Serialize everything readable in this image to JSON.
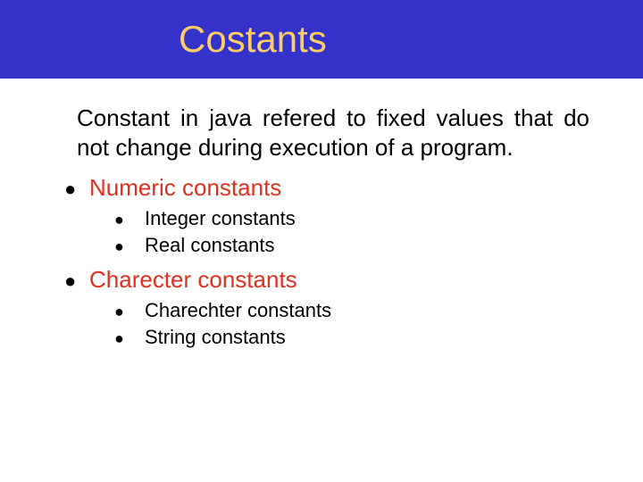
{
  "title": "Costants",
  "intro": "Constant in java refered to fixed values that do not change during execution of a program.",
  "sections": [
    {
      "heading": "Numeric constants",
      "items": [
        "Integer constants",
        "Real constants"
      ]
    },
    {
      "heading": "Charecter constants",
      "items": [
        "Charechter constants",
        "String constants"
      ]
    }
  ]
}
